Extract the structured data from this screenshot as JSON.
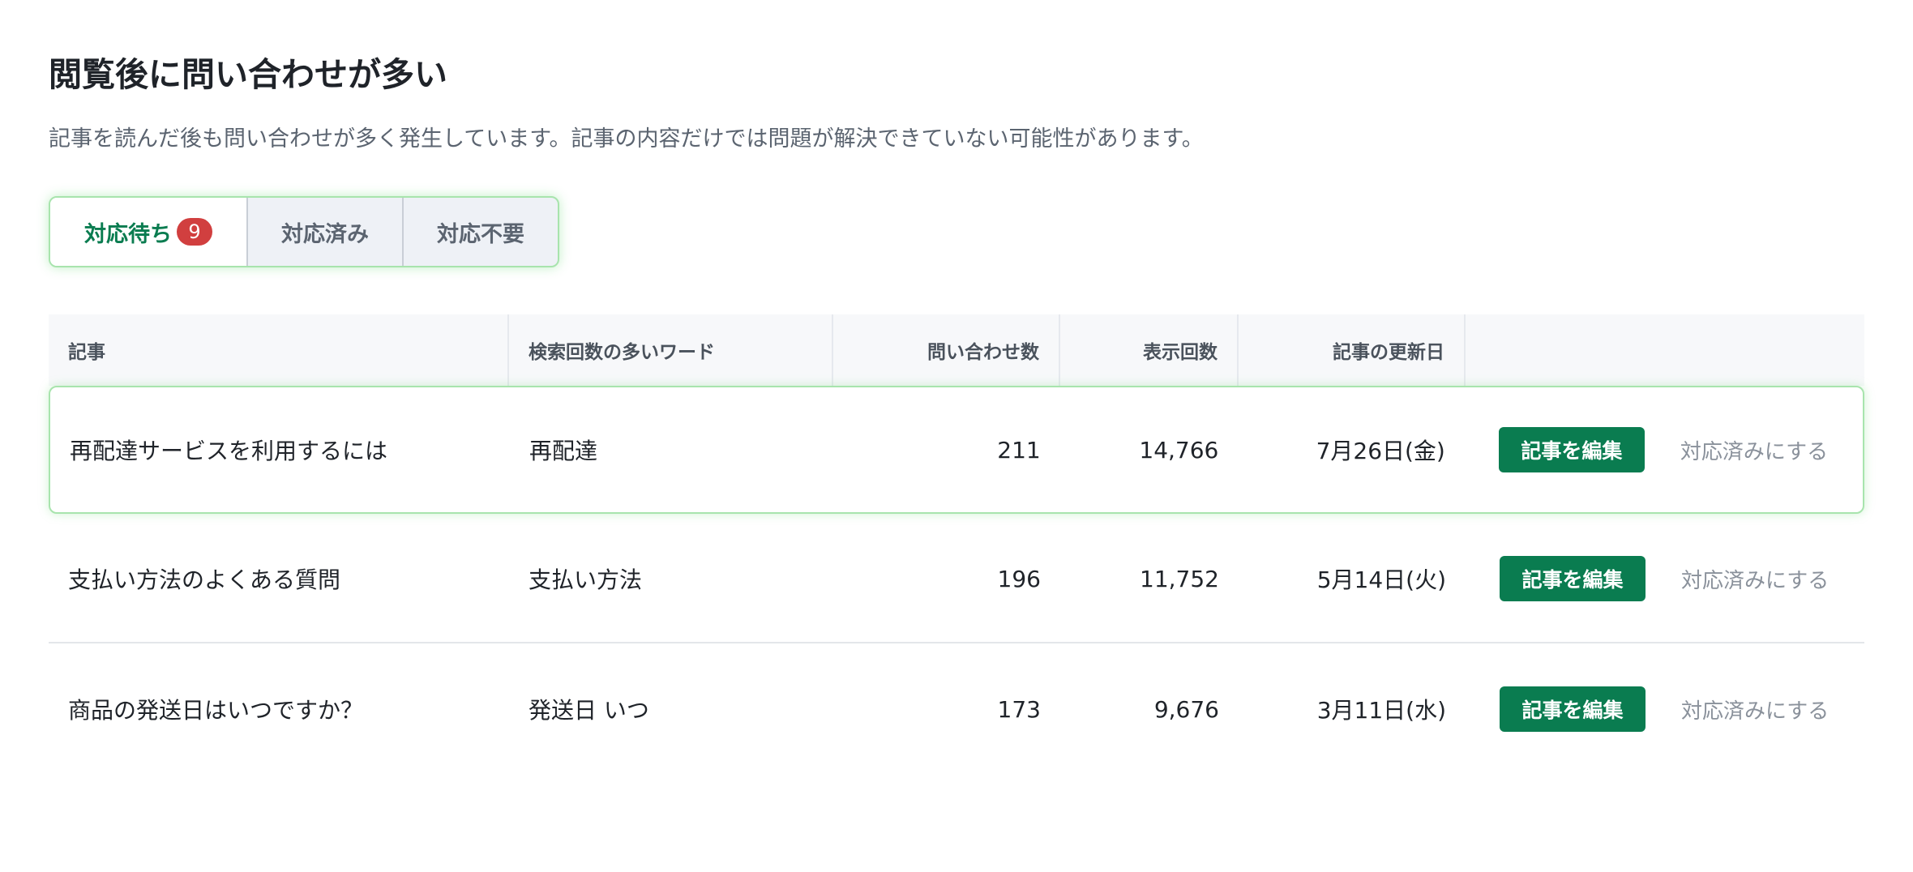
{
  "header": {
    "title": "閲覧後に問い合わせが多い",
    "description": "記事を読んだ後も問い合わせが多く発生しています。記事の内容だけでは問題が解決できていない可能性があります。"
  },
  "tabs": [
    {
      "label": "対応待ち",
      "badge": "9",
      "active": true
    },
    {
      "label": "対応済み",
      "active": false
    },
    {
      "label": "対応不要",
      "active": false
    }
  ],
  "table": {
    "columns": [
      "記事",
      "検索回数の多いワード",
      "問い合わせ数",
      "表示回数",
      "記事の更新日",
      ""
    ],
    "rows": [
      {
        "article": "再配達サービスを利用するには",
        "keyword": "再配達",
        "inquiries": "211",
        "views": "14,766",
        "updated": "7月26日(金)",
        "edit_label": "記事を編集",
        "done_label": "対応済みにする"
      },
      {
        "article": "支払い方法のよくある質問",
        "keyword": "支払い方法",
        "inquiries": "196",
        "views": "11,752",
        "updated": "5月14日(火)",
        "edit_label": "記事を編集",
        "done_label": "対応済みにする"
      },
      {
        "article": "商品の発送日はいつですか？",
        "keyword": "発送日 いつ",
        "inquiries": "173",
        "views": "9,676",
        "updated": "3月11日(水)",
        "edit_label": "記事を編集",
        "done_label": "対応済みにする"
      }
    ]
  },
  "colors": {
    "accent": "#0a7c50",
    "badge": "#d13f3f",
    "highlight_border": "#a8e4ad"
  }
}
